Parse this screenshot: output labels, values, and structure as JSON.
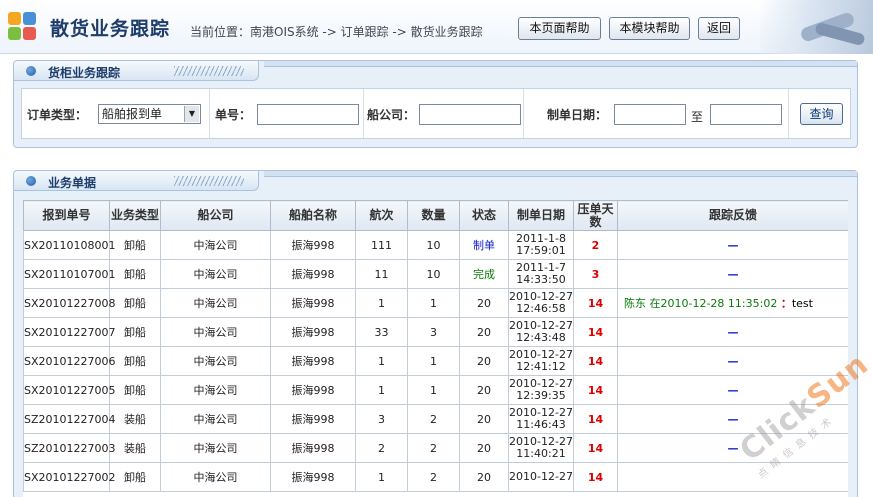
{
  "header": {
    "title": "散货业务跟踪",
    "breadcrumb": "当前位置：南港OIS系统 -> 订单跟踪 -> 散货业务跟踪",
    "buttons": {
      "page_help": "本页面帮助",
      "module_help": "本模块帮助",
      "back": "返回"
    }
  },
  "search_panel": {
    "title": "货柜业务跟踪",
    "order_type_label": "订单类型：",
    "order_type_value": "船舶报到单",
    "order_no_label": "单号：",
    "ship_company_label": "船公司：",
    "create_date_label": "制单日期：",
    "date_to": "至",
    "query_button": "查询"
  },
  "list_panel": {
    "title": "业务单据",
    "columns": [
      "报到单号",
      "业务类型",
      "船公司",
      "船舶名称",
      "航次",
      "数量",
      "状态",
      "制单日期",
      "压单天数",
      "跟踪反馈"
    ],
    "rows": [
      {
        "no": "SX20110108001",
        "type": "卸船",
        "company": "中海公司",
        "ship": "振海998",
        "voyage": "111",
        "qty": "10",
        "status": "制单",
        "date": "2011-1-8",
        "time": "17:59:01",
        "days": "2",
        "feedback": "—"
      },
      {
        "no": "SX20110107001",
        "type": "卸船",
        "company": "中海公司",
        "ship": "振海998",
        "voyage": "11",
        "qty": "10",
        "status": "完成",
        "date": "2011-1-7",
        "time": "14:33:50",
        "days": "3",
        "feedback": "—"
      },
      {
        "no": "SX20101227008",
        "type": "卸船",
        "company": "中海公司",
        "ship": "振海998",
        "voyage": "1",
        "qty": "1",
        "status": "20",
        "date": "2010-12-27",
        "time": "12:46:58",
        "days": "14",
        "feedback_user": "陈东",
        "feedback_at": "在2010-12-28 11:35:02",
        "feedback_colon": "：",
        "feedback_text": "test"
      },
      {
        "no": "SX20101227007",
        "type": "卸船",
        "company": "中海公司",
        "ship": "振海998",
        "voyage": "33",
        "qty": "3",
        "status": "20",
        "date": "2010-12-27",
        "time": "12:43:48",
        "days": "14",
        "feedback": "—"
      },
      {
        "no": "SX20101227006",
        "type": "卸船",
        "company": "中海公司",
        "ship": "振海998",
        "voyage": "1",
        "qty": "1",
        "status": "20",
        "date": "2010-12-27",
        "time": "12:41:12",
        "days": "14",
        "feedback": "—"
      },
      {
        "no": "SX20101227005",
        "type": "卸船",
        "company": "中海公司",
        "ship": "振海998",
        "voyage": "1",
        "qty": "1",
        "status": "20",
        "date": "2010-12-27",
        "time": "12:39:35",
        "days": "14",
        "feedback": "—"
      },
      {
        "no": "SZ20101227004",
        "type": "装船",
        "company": "中海公司",
        "ship": "振海998",
        "voyage": "3",
        "qty": "2",
        "status": "20",
        "date": "2010-12-27",
        "time": "11:46:43",
        "days": "14",
        "feedback": "—"
      },
      {
        "no": "SZ20101227003",
        "type": "装船",
        "company": "中海公司",
        "ship": "振海998",
        "voyage": "2",
        "qty": "2",
        "status": "20",
        "date": "2010-12-27",
        "time": "11:40:21",
        "days": "14",
        "feedback": "—"
      },
      {
        "no": "SX20101227002",
        "type": "卸船",
        "company": "中海公司",
        "ship": "振海998",
        "voyage": "1",
        "qty": "2",
        "status": "20",
        "date": "2010-12-27",
        "time": "",
        "days": "14",
        "feedback": ""
      }
    ]
  },
  "watermark": {
    "brand_a": "Click",
    "brand_b": "Sun",
    "sub": "点睛信息技术"
  },
  "colors": {
    "panel_border": "#a9c2dd",
    "title_blue": "#1e3d6b",
    "days_red": "#e00000",
    "status_blue": "#1020c0",
    "status_green": "#0a7a0a"
  }
}
